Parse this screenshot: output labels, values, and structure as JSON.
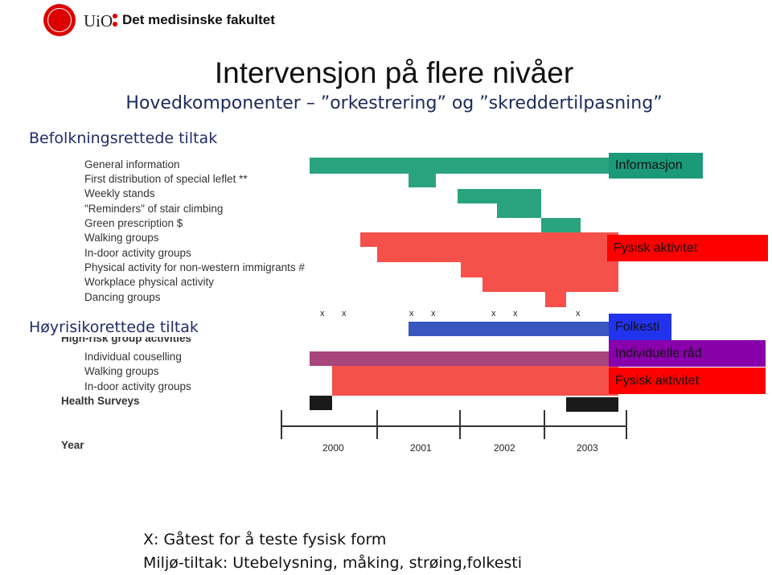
{
  "header": {
    "logo_text": "UiO",
    "faculty": "Det medisinske fakultet"
  },
  "title": "Intervensjon på flere nivåer",
  "subtitle": "Hovedkomponenter – ”orkestrering” og ”skreddertilpasning”",
  "sections": {
    "population": "Befolkningsrettede tiltak",
    "high_risk": "Høyrisikorettede tiltak"
  },
  "population_items": [
    "General information",
    "First distribution of special leflet **",
    "Weekly stands",
    "\"Reminders\" of stair climbing",
    "Green prescription $",
    "Walking groups",
    "In-door activity groups",
    "Physical activity for non-western immigrants #",
    "Workplace physical activity",
    "Dancing groups"
  ],
  "high_risk_header": "High-risk group activities",
  "high_risk_items": [
    "Individual couselling",
    "Walking groups",
    "In-door activity groups"
  ],
  "health_surveys": "Health Surveys",
  "year_label": "Year",
  "years": [
    "2000",
    "2001",
    "2002",
    "2003"
  ],
  "x_mark": "x",
  "legend": [
    {
      "label": "Informasjon",
      "color": "#1a9a78"
    },
    {
      "label": "Fysisk aktivitet",
      "color": "#ff0000"
    },
    {
      "label": "Folkesti",
      "color": "#2233ee"
    },
    {
      "label": "Individuelle råd",
      "color": "#8800aa"
    },
    {
      "label": "Fysisk aktivitet",
      "color": "#ff0000"
    }
  ],
  "colors": {
    "information": "#2aa37f",
    "physical": "#f5504a",
    "trail": "#3a57c0",
    "individual": "#a8457a",
    "survey": "#1a1a1a"
  },
  "bottom": [
    "X: Gåtest for å teste fysisk form",
    "Miljø-tiltak: Utebelysning, måking, strøing,folkesti"
  ]
}
